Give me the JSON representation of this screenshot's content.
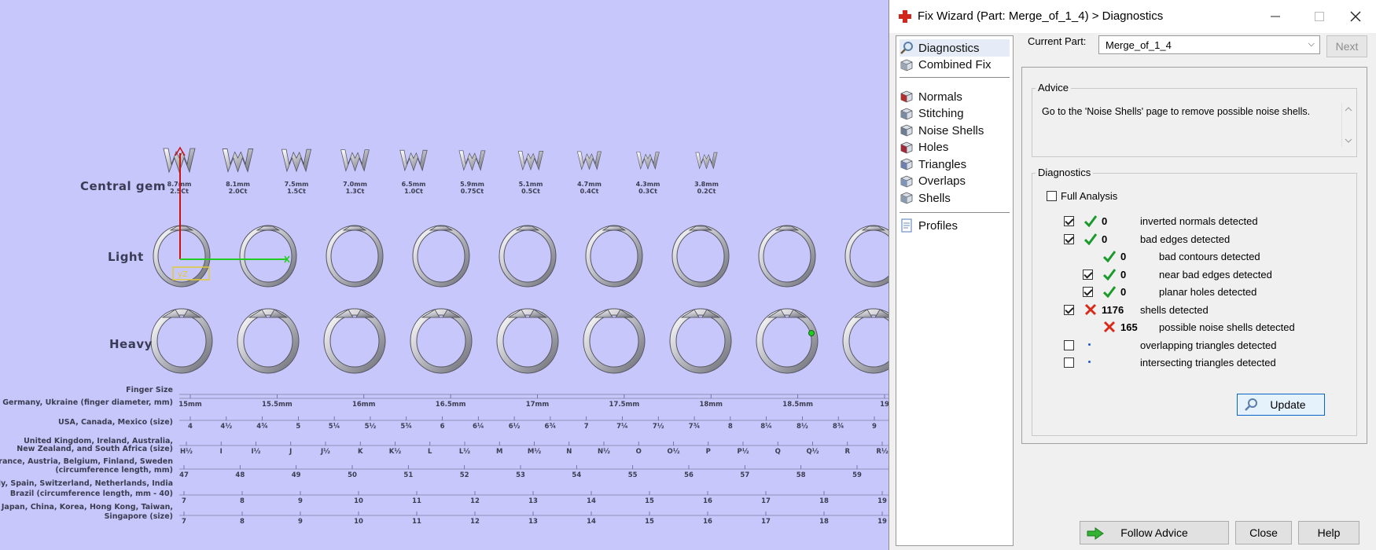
{
  "viewport": {
    "row_labels": {
      "central_gem": "Central gem",
      "light": "Light",
      "heavy": "Heavy"
    },
    "gems": [
      {
        "size": "8.7mm",
        "carat": "2.5Ct"
      },
      {
        "size": "8.1mm",
        "carat": "2.0Ct"
      },
      {
        "size": "7.5mm",
        "carat": "1.5Ct"
      },
      {
        "size": "7.0mm",
        "carat": "1.3Ct"
      },
      {
        "size": "6.5mm",
        "carat": "1.0Ct"
      },
      {
        "size": "5.9mm",
        "carat": "0.75Ct"
      },
      {
        "size": "5.1mm",
        "carat": "0.5Ct"
      },
      {
        "size": "4.7mm",
        "carat": "0.4Ct"
      },
      {
        "size": "4.3mm",
        "carat": "0.3Ct"
      },
      {
        "size": "3.8mm",
        "carat": "0.2Ct"
      }
    ],
    "scale_labels": [
      "Finger Size",
      "Germany, Ukraine (finger diameter, mm)",
      "USA, Canada, Mexico (size)",
      "United Kingdom, Ireland, Australia,",
      "New Zealand, and South Africa (size)",
      "France, Austria, Belgium, Finland, Sweden",
      "(circumference length, mm)",
      "Italy, Spain, Switzerland, Netherlands, India",
      "Brazil (circumference length, mm - 40)",
      "Japan, China, Korea, Hong Kong, Taiwan,",
      "Singapore (size)"
    ],
    "germany_ticks": [
      "15mm",
      "15.5mm",
      "16mm",
      "16.5mm",
      "17mm",
      "17.5mm",
      "18mm",
      "18.5mm",
      "19"
    ],
    "usa_ticks": [
      "4",
      "4½",
      "4¾",
      "5",
      "5¼",
      "5½",
      "5¾",
      "6",
      "6¼",
      "6½",
      "6¾",
      "7",
      "7¼",
      "7½",
      "7¾",
      "8",
      "8¼",
      "8½",
      "8¾",
      "9"
    ],
    "uk_ticks": [
      "H½",
      "I",
      "I½",
      "J",
      "J½",
      "K",
      "K½",
      "L",
      "L½",
      "M",
      "M½",
      "N",
      "N½",
      "O",
      "O½",
      "P",
      "P½",
      "Q",
      "Q½",
      "R",
      "R½"
    ],
    "france_ticks": [
      "47",
      "48",
      "49",
      "50",
      "51",
      "52",
      "53",
      "54",
      "55",
      "56",
      "57",
      "58",
      "59"
    ],
    "italy_ticks": [
      "7",
      "8",
      "9",
      "10",
      "11",
      "12",
      "13",
      "14",
      "15",
      "16",
      "17",
      "18",
      "19"
    ],
    "japan_ticks": [
      "7",
      "8",
      "9",
      "10",
      "11",
      "12",
      "13",
      "14",
      "15",
      "16",
      "17",
      "18",
      "19"
    ],
    "gizmo_label": "yZ"
  },
  "wizard": {
    "title": "Fix Wizard (Part: Merge_of_1_4) > Diagnostics",
    "nav": {
      "group1": [
        {
          "label": "Diagnostics",
          "icon": "magnifier-icon",
          "selected": true
        },
        {
          "label": "Combined Fix",
          "icon": "cube-icon"
        }
      ],
      "group2": [
        {
          "label": "Normals",
          "icon": "normals-cube-icon"
        },
        {
          "label": "Stitching",
          "icon": "stitching-cube-icon"
        },
        {
          "label": "Noise Shells",
          "icon": "noise-shells-icon"
        },
        {
          "label": "Holes",
          "icon": "holes-cube-icon"
        },
        {
          "label": "Triangles",
          "icon": "triangles-cube-icon"
        },
        {
          "label": "Overlaps",
          "icon": "overlaps-cube-icon"
        },
        {
          "label": "Shells",
          "icon": "shells-cube-icon"
        }
      ],
      "group3": [
        {
          "label": "Profiles",
          "icon": "profiles-document-icon"
        }
      ]
    },
    "current_part_label": "Current Part:",
    "current_part_value": "Merge_of_1_4",
    "next_label": "Next",
    "advice": {
      "title": "Advice",
      "text": "Go to the 'Noise Shells' page to remove possible noise shells."
    },
    "diagnostics": {
      "title": "Diagnostics",
      "full_analysis_label": "Full Analysis",
      "full_analysis_checked": false,
      "rows": [
        {
          "checkbox": true,
          "checked": true,
          "status": "ok",
          "count": "0",
          "label": "inverted normals detected",
          "indent": 0
        },
        {
          "checkbox": true,
          "checked": true,
          "status": "ok",
          "count": "0",
          "label": "bad edges detected",
          "indent": 0
        },
        {
          "checkbox": false,
          "checked": false,
          "status": "ok",
          "count": "0",
          "label": "bad contours detected",
          "indent": 1
        },
        {
          "checkbox": true,
          "checked": true,
          "status": "ok",
          "count": "0",
          "label": "near bad edges detected",
          "indent": 1
        },
        {
          "checkbox": true,
          "checked": true,
          "status": "ok",
          "count": "0",
          "label": "planar holes detected",
          "indent": 1
        },
        {
          "checkbox": true,
          "checked": true,
          "status": "error",
          "count": "1176",
          "label": "shells detected",
          "indent": 0
        },
        {
          "checkbox": false,
          "checked": false,
          "status": "error",
          "count": "165",
          "label": "possible noise shells detected",
          "indent": 1
        },
        {
          "checkbox": true,
          "checked": false,
          "status": "none",
          "count": "",
          "label": "overlapping triangles detected",
          "indent": 0
        },
        {
          "checkbox": true,
          "checked": false,
          "status": "none",
          "count": "",
          "label": "intersecting triangles detected",
          "indent": 0
        }
      ],
      "update_label": "Update"
    },
    "footer": {
      "follow_label": "Follow Advice",
      "close_label": "Close",
      "help_label": "Help"
    },
    "colors": {
      "ok": "#1a9a2a",
      "error": "#d62b1a",
      "accent": "#0a63c9"
    }
  }
}
